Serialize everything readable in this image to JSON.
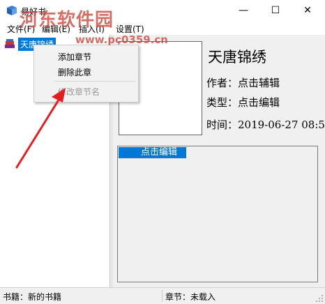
{
  "window": {
    "title": "易好书",
    "minimize_glyph": "—",
    "maximize_glyph": "☐",
    "close_glyph": "✕"
  },
  "menu": {
    "file": "文件(F)",
    "edit": "编辑(E)",
    "insert": "插入(I)",
    "settings": "设置(T)"
  },
  "watermark": {
    "text": "河东软件园",
    "url": "www.pc0359.cn"
  },
  "tree": {
    "root_label": "天唐锦绣"
  },
  "book": {
    "title": "天唐锦绣",
    "author_line": "作者：点击辅辑",
    "type_line": "类型：点击编辑",
    "time_line": "时间：2019-06-27 08:5",
    "description": "点击编辑"
  },
  "context_menu": {
    "add_chapter": "添加章节",
    "delete_chapter": "删除此章",
    "rename_chapter": "修改章节名"
  },
  "status": {
    "book": "书籍：新的书籍",
    "chapter": "章节：未载入"
  },
  "colors": {
    "selection": "#0078d7",
    "arrow": "#e02020",
    "watermark": "#c8463c"
  },
  "icons": {
    "app": "blue-book-icon",
    "tree_node": "stacked-books-icon"
  }
}
